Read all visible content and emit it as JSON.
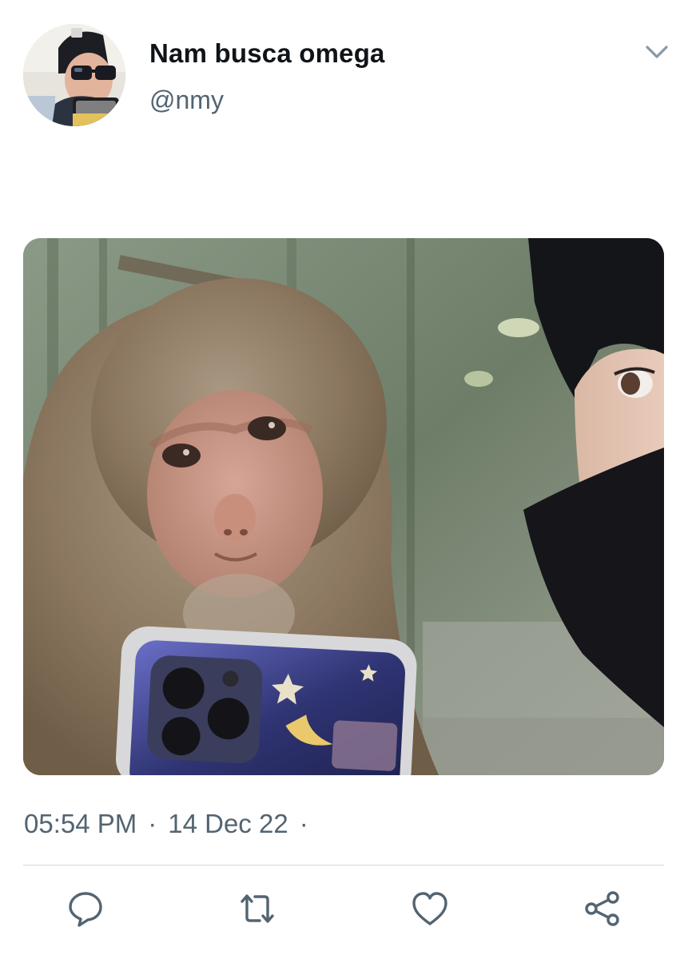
{
  "author": {
    "display_name": "Nam busca omega",
    "handle": "@nmy"
  },
  "meta": {
    "time": "05:54 PM",
    "separator": "·",
    "date": "14 Dec 22",
    "trailing_separator": "·"
  },
  "icons": {
    "more": "chevron-down-icon",
    "reply": "reply-bubble-icon",
    "retweet": "retweet-icon",
    "like": "heart-icon",
    "share": "share-icon"
  },
  "colors": {
    "text_primary": "#0f1419",
    "text_secondary": "#536471",
    "icon": "#536471",
    "divider": "#cfd9de",
    "caret": "#8b98a5"
  }
}
